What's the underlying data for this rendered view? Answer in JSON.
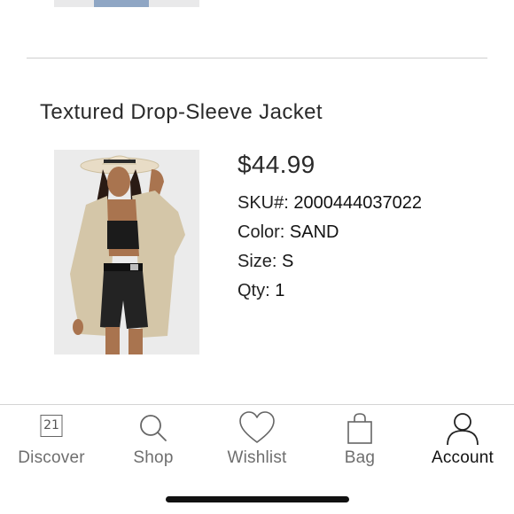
{
  "item": {
    "title": "Textured Drop-Sleeve Jacket",
    "price": "$44.99",
    "sku_label": "SKU#: ",
    "sku_value": "2000444037022",
    "color_label": "Color: ",
    "color_value": "SAND",
    "size_label": "Size: ",
    "size_value": "S",
    "qty_label": "Qty: ",
    "qty_value": "1"
  },
  "tabbar": {
    "discover": {
      "label": "Discover",
      "icon": "calendar-icon",
      "badge": "21"
    },
    "shop": {
      "label": "Shop",
      "icon": "search-icon"
    },
    "wishlist": {
      "label": "Wishlist",
      "icon": "heart-icon"
    },
    "bag": {
      "label": "Bag",
      "icon": "bag-icon"
    },
    "account": {
      "label": "Account",
      "icon": "user-icon",
      "active": true
    }
  },
  "colors": {
    "text": "#222222",
    "inactive_tab": "#6e6e6e",
    "active_tab": "#111111",
    "divider": "#cfcfcf"
  }
}
